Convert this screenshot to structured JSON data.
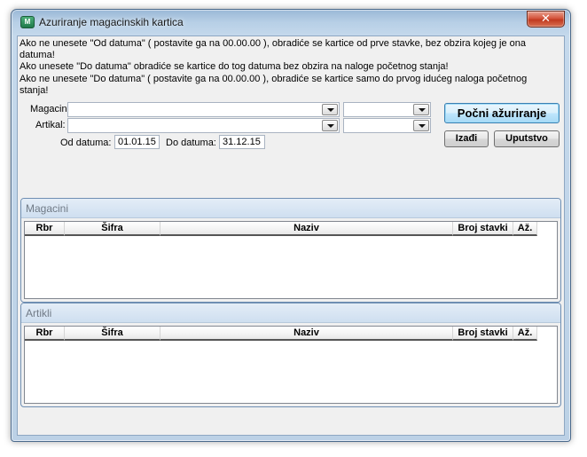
{
  "window": {
    "title": "Azuriranje magacinskih kartica",
    "close_glyph": "✕",
    "icon": "app-logo-icon"
  },
  "info": {
    "line1": "Ako ne unesete \"Od datuma\" ( postavite ga na 00.00.00 ), obradiće se kartice od prve stavke, bez obzira kojeg je ona datuma!",
    "line2": "Ako unesete \"Do datuma\" obradiće se kartice do tog datuma bez obzira na naloge početnog stanja!",
    "line3": "Ako ne unesete \"Do datuma\" ( postavite ga na 00.00.00 ), obradiće se kartice samo do prvog idućeg naloga početnog stanja!"
  },
  "filters": {
    "magacin_label": "Magacin:",
    "artikal_label": "Artikal:",
    "od_label": "Od datuma:",
    "od_value": "01.01.15",
    "do_label": "Do datuma:",
    "do_value": "31.12.15",
    "magacin_value": "",
    "magacin_code": "",
    "artikal_value": "",
    "artikal_code": ""
  },
  "buttons": {
    "start": "Počni ažuriranje",
    "exit": "Izađi",
    "help": "Uputstvo"
  },
  "magacini": {
    "title": "Magacini",
    "columns": [
      "Rbr",
      "Šifra",
      "Naziv",
      "Broj stavki",
      "Až."
    ],
    "rows": []
  },
  "artikli": {
    "title": "Artikli",
    "columns": [
      "Rbr",
      "Šifra",
      "Naziv",
      "Broj stavki",
      "Až."
    ],
    "rows": []
  },
  "colors": {
    "accent": "#3c7fb1",
    "close": "#c13a20",
    "client_bg": "#f0f0f0"
  }
}
